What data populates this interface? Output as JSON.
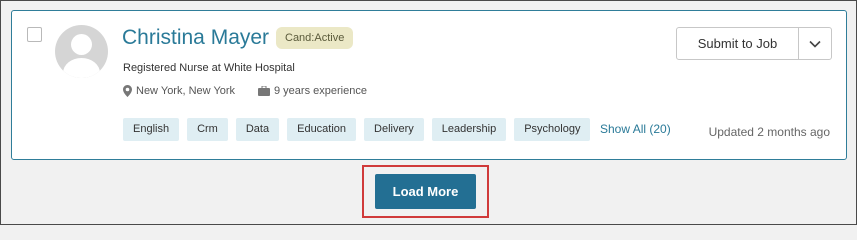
{
  "candidate": {
    "name": "Christina Mayer",
    "status": "Cand:Active",
    "headline": "Registered Nurse at White Hospital",
    "location": "New York, New York",
    "experience": "9 years experience",
    "skills": [
      "English",
      "Crm",
      "Data",
      "Education",
      "Delivery",
      "Leadership",
      "Psychology"
    ],
    "show_all_label": "Show All (20)",
    "updated": "Updated 2 months ago"
  },
  "actions": {
    "submit_label": "Submit to Job",
    "load_more_label": "Load More"
  },
  "colors": {
    "accent": "#2a7a98",
    "button_blue": "#236f93",
    "badge_bg": "#ebe8c6",
    "tag_bg": "#dfeef3",
    "highlight": "#d03a3a"
  }
}
